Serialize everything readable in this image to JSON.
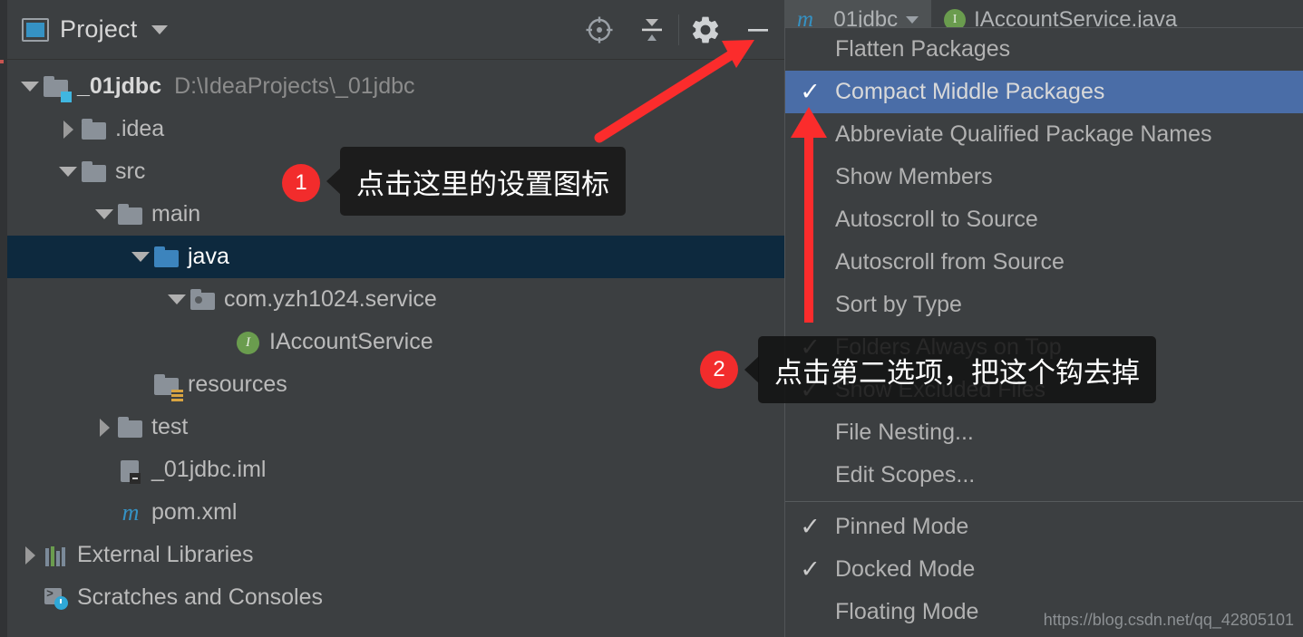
{
  "panel": {
    "title": "Project",
    "icon": "project-window-icon",
    "toolbar": [
      {
        "name": "locate-icon",
        "label": "Select Opened File"
      },
      {
        "name": "collapse-all-icon",
        "label": "Collapse All"
      },
      {
        "name": "gear-icon",
        "label": "Show Options Menu"
      },
      {
        "name": "minimize-icon",
        "label": "Hide"
      }
    ]
  },
  "tree": [
    {
      "label": "_01jdbc",
      "path": "D:\\IdeaProjects\\_01jdbc",
      "indent": 0,
      "twisty": "down",
      "icon": "module-folder-icon",
      "bold": true,
      "selected": false
    },
    {
      "label": ".idea",
      "path": "",
      "indent": 1,
      "twisty": "right",
      "icon": "folder-icon",
      "bold": false,
      "selected": false
    },
    {
      "label": "src",
      "path": "",
      "indent": 1,
      "twisty": "down",
      "icon": "folder-icon",
      "bold": false,
      "selected": false
    },
    {
      "label": "main",
      "path": "",
      "indent": 2,
      "twisty": "down",
      "icon": "folder-icon",
      "bold": false,
      "selected": false
    },
    {
      "label": "java",
      "path": "",
      "indent": 3,
      "twisty": "down",
      "icon": "source-root-folder-icon",
      "bold": false,
      "selected": true
    },
    {
      "label": "com.yzh1024.service",
      "path": "",
      "indent": 4,
      "twisty": "down",
      "icon": "package-folder-icon",
      "bold": false,
      "selected": false
    },
    {
      "label": "IAccountService",
      "path": "",
      "indent": 5,
      "twisty": "none",
      "icon": "interface-icon",
      "bold": false,
      "selected": false
    },
    {
      "label": "resources",
      "path": "",
      "indent": 3,
      "twisty": "none",
      "icon": "resources-folder-icon",
      "bold": false,
      "selected": false
    },
    {
      "label": "test",
      "path": "",
      "indent": 2,
      "twisty": "right",
      "icon": "folder-icon",
      "bold": false,
      "selected": false
    },
    {
      "label": "_01jdbc.iml",
      "path": "",
      "indent": 2,
      "twisty": "none",
      "icon": "iml-file-icon",
      "bold": false,
      "selected": false
    },
    {
      "label": "pom.xml",
      "path": "",
      "indent": 2,
      "twisty": "none",
      "icon": "maven-file-icon",
      "bold": false,
      "selected": false
    },
    {
      "label": "External Libraries",
      "path": "",
      "indent": 0,
      "twisty": "right",
      "icon": "libraries-icon",
      "bold": false,
      "selected": false
    },
    {
      "label": "Scratches and Consoles",
      "path": "",
      "indent": 0,
      "twisty": "none",
      "icon": "scratches-icon",
      "bold": false,
      "selected": false
    }
  ],
  "tabs": [
    {
      "label": "_01jdbc",
      "icon": "maven-file-icon",
      "caret": true,
      "active": true
    },
    {
      "label": "IAccountService.java",
      "icon": "interface-icon",
      "caret": false,
      "active": false
    }
  ],
  "menu": {
    "items": [
      {
        "label": "Flatten Packages",
        "checked": false,
        "selected": false,
        "mnemonic": ""
      },
      {
        "label": "Compact Middle Packages",
        "checked": true,
        "selected": true,
        "mnemonic": ""
      },
      {
        "label": "Abbreviate Qualified Package Names",
        "checked": false,
        "selected": false,
        "mnemonic": ""
      },
      {
        "label": "Show Members",
        "checked": false,
        "selected": false,
        "mnemonic": ""
      },
      {
        "label": "Autoscroll to Source",
        "checked": false,
        "selected": false,
        "mnemonic": ""
      },
      {
        "label": "Autoscroll from Source",
        "checked": false,
        "selected": false,
        "mnemonic": ""
      },
      {
        "label": "Sort by Type",
        "checked": false,
        "selected": false,
        "mnemonic": ""
      },
      {
        "label": "Folders Always on Top",
        "checked": true,
        "selected": false,
        "mnemonic": ""
      },
      {
        "label": "Show Excluded Files",
        "checked": true,
        "selected": false,
        "mnemonic": ""
      },
      {
        "label": "File Nesting...",
        "checked": false,
        "selected": false,
        "mnemonic": ""
      },
      {
        "label": "Edit Scopes...",
        "checked": false,
        "selected": false,
        "mnemonic": "i"
      }
    ],
    "items_bottom": [
      {
        "label": "Pinned Mode",
        "checked": true,
        "selected": false,
        "mnemonic": "P"
      },
      {
        "label": "Docked Mode",
        "checked": true,
        "selected": false,
        "mnemonic": "e"
      },
      {
        "label": "Floating Mode",
        "checked": false,
        "selected": false,
        "mnemonic": "M"
      }
    ],
    "check_glyph": "✓"
  },
  "annotations": [
    {
      "number": "1",
      "text": "点击这里的设置图标"
    },
    {
      "number": "2",
      "text": "点击第二选项，把这个钩去掉"
    }
  ],
  "watermark": "https://blog.csdn.net/qq_42805101",
  "colors": {
    "panel_bg": "#3c3f41",
    "selected_row": "#0d293e",
    "menu_highlight": "#4a6da7",
    "accent_red": "#f22c2c",
    "source_root_blue": "#3c84bd",
    "interface_green": "#6a9c4e"
  }
}
